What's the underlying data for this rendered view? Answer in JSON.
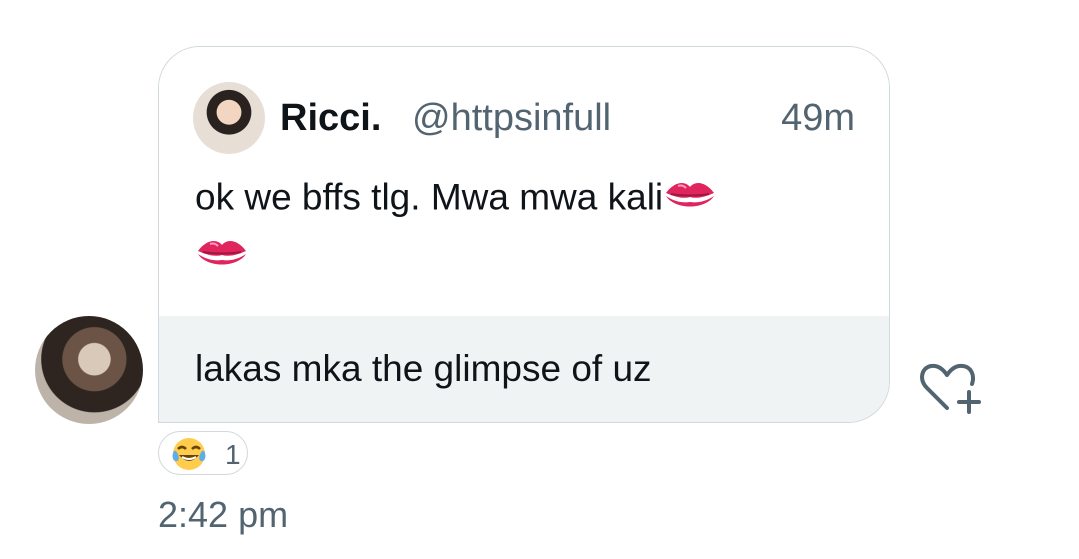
{
  "message": {
    "quoted": {
      "display_name": "Ricci.",
      "handle": "@httpsinfull",
      "time": "49m",
      "text": "ok we bffs tlg. Mwa mwa kali",
      "emoji": [
        "kiss-mark",
        "kiss-mark"
      ]
    },
    "reply_text": "lakas mka the glimpse of uz",
    "reaction": {
      "emoji": "face-with-tears-of-joy",
      "count": "1"
    },
    "timestamp": "2:42 pm"
  },
  "colors": {
    "text_primary": "#0f1419",
    "text_secondary": "#536471",
    "bubble_border": "#cfd9de",
    "reply_background": "#eff3f4",
    "kiss_red": "#e0245e"
  },
  "icons": {
    "like": "heart-plus-icon"
  }
}
